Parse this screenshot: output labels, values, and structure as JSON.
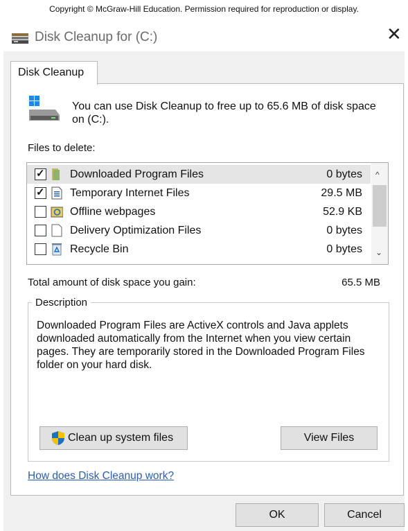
{
  "copyright": "Copyright © McGraw-Hill Education. Permission required for reproduction or display.",
  "window": {
    "title": "Disk Cleanup for  (C:)",
    "close_glyph": "✕"
  },
  "tab": {
    "label": "Disk Cleanup"
  },
  "intro": "You can use Disk Cleanup to free up to 65.6 MB of disk space on  (C:).",
  "files_label": "Files to delete:",
  "files": [
    {
      "name": "Downloaded Program Files",
      "size": "0 bytes",
      "checked": true,
      "icon": "folder-icon",
      "selected": true
    },
    {
      "name": "Temporary Internet Files",
      "size": "29.5 MB",
      "checked": true,
      "icon": "document-lines-icon",
      "selected": false
    },
    {
      "name": "Offline webpages",
      "size": "52.9 KB",
      "checked": false,
      "icon": "sync-folder-icon",
      "selected": false
    },
    {
      "name": "Delivery Optimization Files",
      "size": "0 bytes",
      "checked": false,
      "icon": "blank-document-icon",
      "selected": false
    },
    {
      "name": "Recycle Bin",
      "size": "0 bytes",
      "checked": false,
      "icon": "recycle-bin-icon",
      "selected": false
    }
  ],
  "total": {
    "label": "Total amount of disk space you gain:",
    "value": "65.5 MB"
  },
  "description": {
    "legend": "Description",
    "text": "Downloaded Program Files are ActiveX controls and Java applets downloaded automatically from the Internet when you view certain pages. They are temporarily stored in the Downloaded Program Files folder on your hard disk."
  },
  "buttons": {
    "clean_system": "Clean up system files",
    "view_files": "View Files",
    "ok": "OK",
    "cancel": "Cancel"
  },
  "help_link": "How does Disk Cleanup work?",
  "colors": {
    "link": "#2a5db0",
    "selected_row": "#e5e5e5",
    "button_face": "#e1e1e1",
    "dialog_bg": "#f0f0f0"
  }
}
